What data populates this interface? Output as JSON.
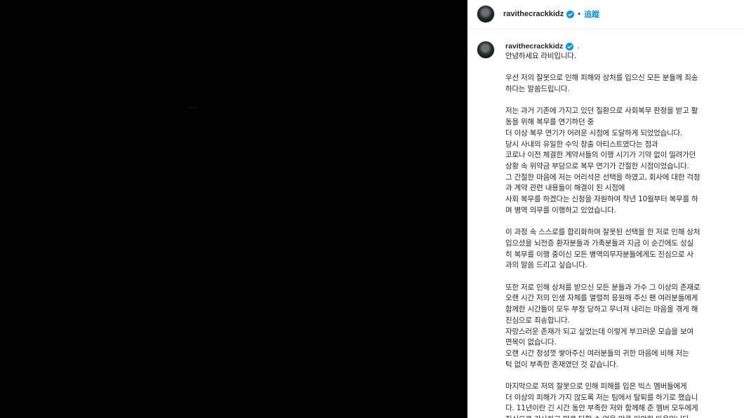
{
  "media": {
    "alt_icon": "video-frame"
  },
  "header": {
    "username": "ravithecrackkidz",
    "separator": "•",
    "follow_label": "追蹤"
  },
  "colors": {
    "accent": "#0095f6",
    "verified": "#0095f6",
    "text": "#262626"
  },
  "post": {
    "username": "ravithecrackkidz",
    "trailing": ".",
    "lines": [
      "안녕하세요 라비입니다.",
      "",
      "우선 저의 잘못으로 인해 피해와 상처를 입으신 모든 분들께 죄송",
      "하다는 말씀드립니다.",
      "",
      "저는 과거 기존에 가지고 있던 질환으로 사회복무 판정을 받고 활",
      "동을 위해 복무를 연기하던 중",
      "더 이상 복무 연기가 어려운 시점에 도달하게 되었었습니다.",
      "당시 사내의 유일한 수익 창출 아티스트였다는 점과",
      "코로나 이전 체결한 계약서들의 이행 시기가 기약 없이 밀려가던",
      "상황 속 위약금 부담으로 복무 연기가 간절한 시점이었습니다.",
      "그 간절한 마음에 저는 어리석은 선택을 하였고, 회사에 대한 걱정",
      "과 계약 관련 내용들이 해결이 된 시점에",
      "사회 복무를 하겠다는 신청을 자원하여 작년 10월부터 복무를 하",
      "며 병역 의무를 이행하고 있었습니다.",
      "",
      "이 과정 속 스스로를 합리화하며 잘못된 선택을 한 저로 인해 상처",
      "입으셨을 뇌전증 환자분들과 가족분들과 지금 이 순간에도 성실",
      "히 복무를 이행 중이신 모든 병역의무자분들에게도 진심으로 사",
      "과의 말씀 드리고 싶습니다.",
      "",
      "또한 저로 인해 상처를 받으신 모든 분들과 가수 그 이상의 존재로",
      "오랜 시간 저의 인생 자체를 열렬히 응원해 주신 팬 여러분들에게",
      "함께한 시간들이 모두 부정 당하고 무너져 내리는 마음을 겪게 해",
      "진심으로 죄송합니다.",
      "자랑스러운 존재가 되고 싶었는데 이렇게 부끄러운 모습을 보여",
      "면목이 없습니다.",
      "오랜 시간 정성껏 쌓아주신 여러분들의 귀한 마음에 비해 저는",
      "턱 없이 부족한 존재였던 것 같습니다.",
      "",
      "마지막으로 저의 잘못으로 인해 피해를 입은 빅스 멤버들에게",
      "더 이상의 피해가 가지 않도록 저는 팀에서 탈퇴를 하기로 했습니",
      "다. 11년이란 긴 시간 동안 부족한 저와 함께해 준 멤버 모두에게",
      "진심으로 감사하고 말로 다할 수 없을 만큼 미안한 마음입니다."
    ]
  }
}
